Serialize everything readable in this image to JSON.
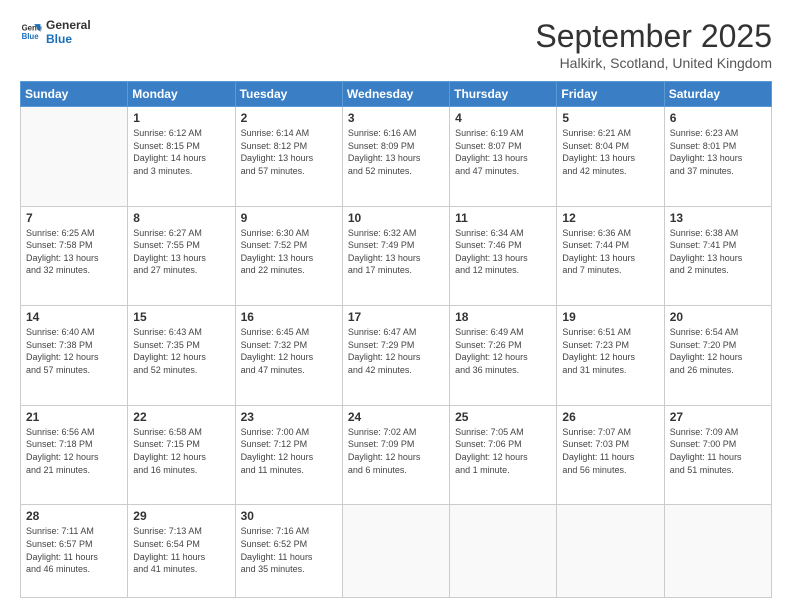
{
  "logo": {
    "line1": "General",
    "line2": "Blue"
  },
  "title": "September 2025",
  "subtitle": "Halkirk, Scotland, United Kingdom",
  "weekdays": [
    "Sunday",
    "Monday",
    "Tuesday",
    "Wednesday",
    "Thursday",
    "Friday",
    "Saturday"
  ],
  "weeks": [
    [
      {
        "day": "",
        "info": ""
      },
      {
        "day": "1",
        "info": "Sunrise: 6:12 AM\nSunset: 8:15 PM\nDaylight: 14 hours\nand 3 minutes."
      },
      {
        "day": "2",
        "info": "Sunrise: 6:14 AM\nSunset: 8:12 PM\nDaylight: 13 hours\nand 57 minutes."
      },
      {
        "day": "3",
        "info": "Sunrise: 6:16 AM\nSunset: 8:09 PM\nDaylight: 13 hours\nand 52 minutes."
      },
      {
        "day": "4",
        "info": "Sunrise: 6:19 AM\nSunset: 8:07 PM\nDaylight: 13 hours\nand 47 minutes."
      },
      {
        "day": "5",
        "info": "Sunrise: 6:21 AM\nSunset: 8:04 PM\nDaylight: 13 hours\nand 42 minutes."
      },
      {
        "day": "6",
        "info": "Sunrise: 6:23 AM\nSunset: 8:01 PM\nDaylight: 13 hours\nand 37 minutes."
      }
    ],
    [
      {
        "day": "7",
        "info": "Sunrise: 6:25 AM\nSunset: 7:58 PM\nDaylight: 13 hours\nand 32 minutes."
      },
      {
        "day": "8",
        "info": "Sunrise: 6:27 AM\nSunset: 7:55 PM\nDaylight: 13 hours\nand 27 minutes."
      },
      {
        "day": "9",
        "info": "Sunrise: 6:30 AM\nSunset: 7:52 PM\nDaylight: 13 hours\nand 22 minutes."
      },
      {
        "day": "10",
        "info": "Sunrise: 6:32 AM\nSunset: 7:49 PM\nDaylight: 13 hours\nand 17 minutes."
      },
      {
        "day": "11",
        "info": "Sunrise: 6:34 AM\nSunset: 7:46 PM\nDaylight: 13 hours\nand 12 minutes."
      },
      {
        "day": "12",
        "info": "Sunrise: 6:36 AM\nSunset: 7:44 PM\nDaylight: 13 hours\nand 7 minutes."
      },
      {
        "day": "13",
        "info": "Sunrise: 6:38 AM\nSunset: 7:41 PM\nDaylight: 13 hours\nand 2 minutes."
      }
    ],
    [
      {
        "day": "14",
        "info": "Sunrise: 6:40 AM\nSunset: 7:38 PM\nDaylight: 12 hours\nand 57 minutes."
      },
      {
        "day": "15",
        "info": "Sunrise: 6:43 AM\nSunset: 7:35 PM\nDaylight: 12 hours\nand 52 minutes."
      },
      {
        "day": "16",
        "info": "Sunrise: 6:45 AM\nSunset: 7:32 PM\nDaylight: 12 hours\nand 47 minutes."
      },
      {
        "day": "17",
        "info": "Sunrise: 6:47 AM\nSunset: 7:29 PM\nDaylight: 12 hours\nand 42 minutes."
      },
      {
        "day": "18",
        "info": "Sunrise: 6:49 AM\nSunset: 7:26 PM\nDaylight: 12 hours\nand 36 minutes."
      },
      {
        "day": "19",
        "info": "Sunrise: 6:51 AM\nSunset: 7:23 PM\nDaylight: 12 hours\nand 31 minutes."
      },
      {
        "day": "20",
        "info": "Sunrise: 6:54 AM\nSunset: 7:20 PM\nDaylight: 12 hours\nand 26 minutes."
      }
    ],
    [
      {
        "day": "21",
        "info": "Sunrise: 6:56 AM\nSunset: 7:18 PM\nDaylight: 12 hours\nand 21 minutes."
      },
      {
        "day": "22",
        "info": "Sunrise: 6:58 AM\nSunset: 7:15 PM\nDaylight: 12 hours\nand 16 minutes."
      },
      {
        "day": "23",
        "info": "Sunrise: 7:00 AM\nSunset: 7:12 PM\nDaylight: 12 hours\nand 11 minutes."
      },
      {
        "day": "24",
        "info": "Sunrise: 7:02 AM\nSunset: 7:09 PM\nDaylight: 12 hours\nand 6 minutes."
      },
      {
        "day": "25",
        "info": "Sunrise: 7:05 AM\nSunset: 7:06 PM\nDaylight: 12 hours\nand 1 minute."
      },
      {
        "day": "26",
        "info": "Sunrise: 7:07 AM\nSunset: 7:03 PM\nDaylight: 11 hours\nand 56 minutes."
      },
      {
        "day": "27",
        "info": "Sunrise: 7:09 AM\nSunset: 7:00 PM\nDaylight: 11 hours\nand 51 minutes."
      }
    ],
    [
      {
        "day": "28",
        "info": "Sunrise: 7:11 AM\nSunset: 6:57 PM\nDaylight: 11 hours\nand 46 minutes."
      },
      {
        "day": "29",
        "info": "Sunrise: 7:13 AM\nSunset: 6:54 PM\nDaylight: 11 hours\nand 41 minutes."
      },
      {
        "day": "30",
        "info": "Sunrise: 7:16 AM\nSunset: 6:52 PM\nDaylight: 11 hours\nand 35 minutes."
      },
      {
        "day": "",
        "info": ""
      },
      {
        "day": "",
        "info": ""
      },
      {
        "day": "",
        "info": ""
      },
      {
        "day": "",
        "info": ""
      }
    ]
  ]
}
